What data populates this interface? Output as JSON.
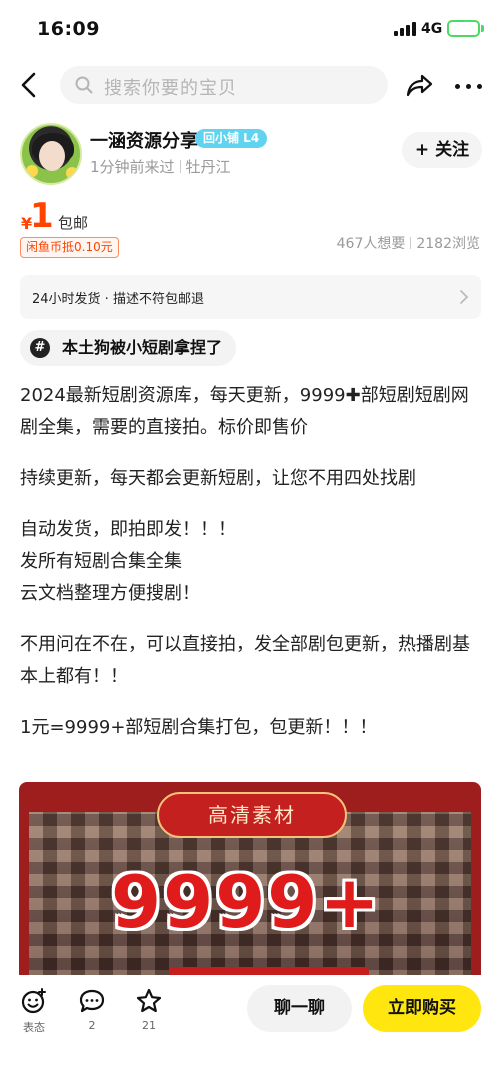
{
  "status_bar": {
    "time": "16:09",
    "network": "4G"
  },
  "nav": {
    "search_placeholder": "搜索你要的宝贝"
  },
  "seller": {
    "name": "一涵资源分享",
    "badge": "回小铺 L4",
    "last_seen": "1分钟前来过",
    "location": "牡丹江",
    "follow_label": "+ 关注"
  },
  "price": {
    "currency": "¥",
    "amount": "1",
    "shipping": "包邮",
    "coin_discount": "闲鱼币抵0.10元",
    "wants": "467人想要",
    "views": "2182浏览"
  },
  "service": {
    "text": "24小时发货 · 描述不符包邮退"
  },
  "topic": {
    "icon": "#",
    "text": "本土狗被小短剧拿捏了"
  },
  "description": [
    "2024最新短剧资源库，每天更新，9999✚部短剧短剧网剧全集，需要的直接拍。标价即售价",
    "持续更新，每天都会更新短剧，让您不用四处找剧",
    "自动发货，即拍即发！！！\n发所有短剧合集全集\n云文档整理方便搜剧！",
    "不用问在不在，可以直接拍，发全部剧包更新，热播剧基本上都有！！",
    "1元=9999+部短剧合集打包，包更新！！！"
  ],
  "banner": {
    "tag": "高清素材",
    "headline": "9999+"
  },
  "bottom_bar": {
    "react_label": "表态",
    "comment_count": "2",
    "fav_count": "21",
    "chat_label": "聊一聊",
    "buy_label": "立即购买"
  },
  "colors": {
    "price": "#ff4400",
    "buy_button": "#ffe60f",
    "badge": "#5fd3f0",
    "banner_bg": "#9e1d1d"
  }
}
